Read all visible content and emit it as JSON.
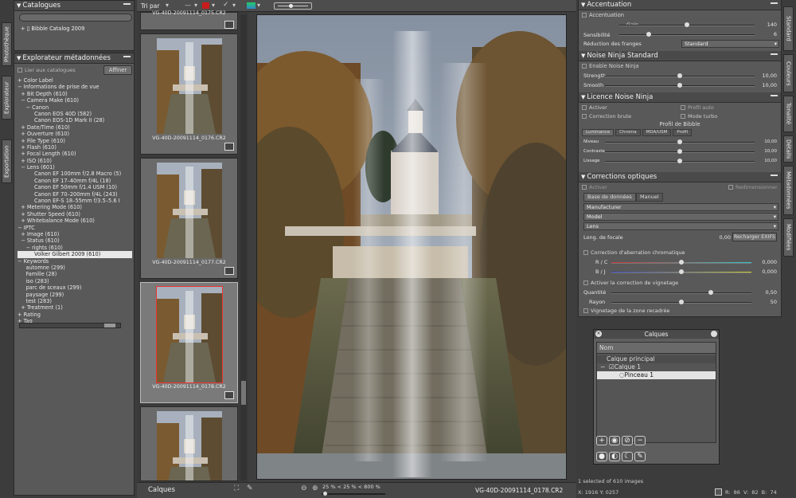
{
  "left_tabs": [
    "Photothèque",
    "Explorateur",
    "Exportation"
  ],
  "right_tabs": [
    "Standard",
    "Couleurs",
    "Tonalité",
    "Détails",
    "Métadonnées",
    "Modifiées"
  ],
  "catalogues": {
    "title": "Catalogues",
    "search_placeholder": "",
    "item": "Bibble Catalog 2009"
  },
  "explorer": {
    "title": "Explorateur métadonnées",
    "link_label": "Lier aux catalogues",
    "refresh_label": "Affiner",
    "tree": [
      "+ Color Label",
      "− Informations de prise de vue",
      "  + Bit Depth (610)",
      "  − Camera Make (610)",
      "     − Canon",
      "          Canon EOS 40D (582)",
      "          Canon EOS-1D Mark II (28)",
      "  + Date/Time (610)",
      "  + Ouverture (610)",
      "  + File Type (610)",
      "  + Flash (610)",
      "  + Focal Length (610)",
      "  + ISO (610)",
      "  − Lens (601)",
      "          Canon EF 100mm f/2.8 Macro (5)",
      "          Canon EF 17–40mm f/4L (18)",
      "          Canon EF 50mm f/1.4 USM (10)",
      "          Canon EF 70–200mm f/4L (243)",
      "          Canon EF-S 18–55mm f/3.5–5.6 I",
      "  + Metering Mode (610)",
      "  + Shutter Speed (610)",
      "  + Whitebalance Mode (610)",
      "− IPTC",
      "  + Image (610)",
      "  − Status (610)",
      "     − rights (610)",
      "          Volker Gilbert 2009 (610)",
      "− Keywords",
      "     automne (299)",
      "     Famille (28)",
      "     iso (283)",
      "     parc de sceaux (299)",
      "     paysage (299)",
      "     test (283)",
      "  + Treatment (1)",
      "+ Rating",
      "+ Tag"
    ],
    "selected_index": 26
  },
  "toolbar": {
    "sort_label": "Tri par"
  },
  "filmstrip": {
    "top_name": "VG-40D-20091114_0175.CR2",
    "items": [
      "VG-40D-20091114_0176.CR2",
      "VG-40D-20091114_0177.CR2",
      "VG-40D-20091114_0178.CR2"
    ],
    "selected": 2
  },
  "bottom": {
    "layers_tab": "Calques",
    "zoom": "25 % < 25 % < 800 %",
    "filename": "VG-40D-20091114_0178.CR2",
    "selection": "1 selected of 610 images",
    "coords": "X: 1916  Y: 0257",
    "rgb": "R:  86  V:  82  B:  74"
  },
  "accentuation": {
    "title": "Accentuation",
    "enable": "Accentuation",
    "gain_label": "Gain",
    "gain_value": "140",
    "gain_level": 0.5,
    "sens_label": "Sensibilité",
    "sens_value": "6",
    "sens_level": 0.22,
    "fringe_label": "Réduction des franges",
    "fringe_value": "Standard"
  },
  "noise_std": {
    "title": "Noise Ninja Standard",
    "enable": "Enable Noise Ninja",
    "strength_label": "Strength",
    "strength_value": "10,00",
    "strength_level": 0.5,
    "smooth_label": "Smooth",
    "smooth_value": "10,00",
    "smooth_level": 0.5
  },
  "noise_lic": {
    "title": "Licence Noise Ninja",
    "activate": "Activer",
    "auto": "Profil auto",
    "raw": "Correction brute",
    "turbo": "Mode turbo",
    "profile": "Profil de Bibble",
    "tabs": [
      "Luminance",
      "Chroma",
      "MDA/USM",
      "Profil"
    ],
    "rows": [
      {
        "label": "Niveau",
        "value": "10,00",
        "level": 0.5
      },
      {
        "label": "Contraste",
        "value": "10,00",
        "level": 0.5
      },
      {
        "label": "Lissage",
        "value": "10,00",
        "level": 0.5
      }
    ]
  },
  "optics": {
    "title": "Corrections optiques",
    "activate": "Activer",
    "redim": "Redimensionner",
    "tabs": [
      "Base de données",
      "Manuel"
    ],
    "combos": [
      "Manufacturer",
      "Model",
      "Lens"
    ],
    "focal_label": "Long. de focale",
    "focal_value": "0,00",
    "reload": "Recharger EXIFS",
    "ca_label": "Correction d'aberration chromatique",
    "rc_label": "R / C",
    "rc_value": "0,000",
    "rc_level": 0.5,
    "bj_label": "B / J",
    "bj_value": "0,000",
    "bj_level": 0.5,
    "vig_label": "Activer la correction de vignetage",
    "qty_label": "Quantité",
    "qty_value": "0,50",
    "qty_level": 0.71,
    "radius_label": "Rayon",
    "radius_value": "50",
    "radius_level": 0.5,
    "crop_label": "Vignetage de la zone recadrée"
  },
  "layers": {
    "title": "Calques",
    "col": "Nom",
    "main": "Calque principal",
    "layer1": "Calque 1",
    "brush": "Pinceau 1"
  }
}
